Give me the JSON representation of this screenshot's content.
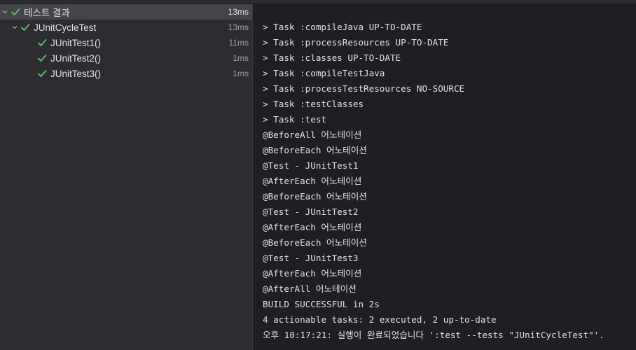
{
  "tree": {
    "root": {
      "label": "테스트 결과",
      "time": "13ms"
    },
    "suite": {
      "label": "JUnitCycleTest",
      "time": "13ms"
    },
    "tests": [
      {
        "label": "JUnitTest1()",
        "time": "11ms"
      },
      {
        "label": "JUnitTest2()",
        "time": "1ms"
      },
      {
        "label": "JUnitTest3()",
        "time": "1ms"
      }
    ]
  },
  "console": {
    "lines": [
      "> Task :compileJava UP-TO-DATE",
      "> Task :processResources UP-TO-DATE",
      "> Task :classes UP-TO-DATE",
      "> Task :compileTestJava",
      "> Task :processTestResources NO-SOURCE",
      "> Task :testClasses",
      "> Task :test",
      "@BeforeAll 어노테이션",
      "@BeforeEach 어노테이션",
      "@Test - JUnitTest1",
      "@AfterEach 어노테이션",
      "@BeforeEach 어노테이션",
      "@Test - JUnitTest2",
      "@AfterEach 어노테이션",
      "@BeforeEach 어노테이션",
      "@Test - JUnitTest3",
      "@AfterEach 어노테이션",
      "@AfterAll 어노테이션",
      "BUILD SUCCESSFUL in 2s",
      "4 actionable tasks: 2 executed, 2 up-to-date",
      "오후 10:17:21: 실행이 완료되었습니다 ':test --tests \"JUnitCycleTest\"'."
    ]
  },
  "colors": {
    "pass_check": "#5fb865",
    "tree_bg": "#2b2d30",
    "console_bg": "#1e1f22",
    "selection": "#43454a"
  },
  "icons": {
    "expand": "chevron-down-icon",
    "passed": "check-icon"
  }
}
